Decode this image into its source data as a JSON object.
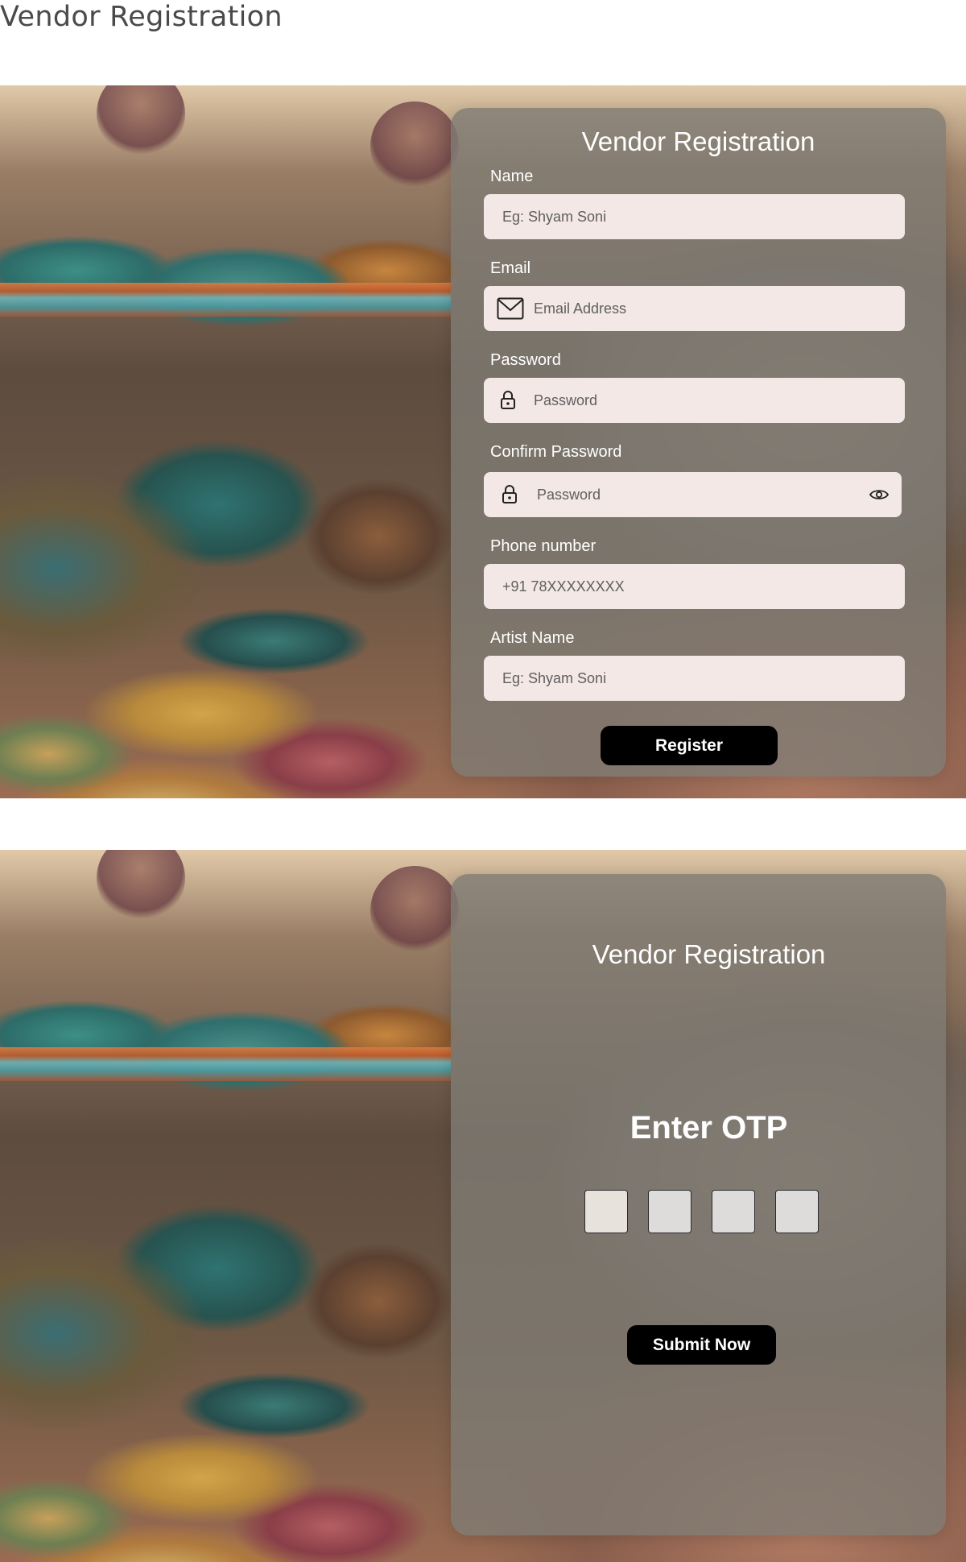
{
  "page_title": "Vendor Registration",
  "registration": {
    "title": "Vendor Registration",
    "fields": {
      "name": {
        "label": "Name",
        "placeholder": "Eg: Shyam Soni"
      },
      "email": {
        "label": "Email",
        "placeholder": "Email Address",
        "icon": "mail-icon"
      },
      "password": {
        "label": "Password",
        "placeholder": "Password",
        "icon": "lock-icon"
      },
      "confirm_password": {
        "label": "Confirm Password",
        "placeholder": "Password",
        "icon": "lock-icon",
        "toggle_icon": "eye-icon"
      },
      "phone": {
        "label": "Phone number",
        "placeholder": "+91 78XXXXXXXX"
      },
      "artist_name": {
        "label": "Artist Name",
        "placeholder": "Eg: Shyam Soni"
      }
    },
    "register_label": "Register"
  },
  "otp": {
    "title": "Vendor Registration",
    "heading": "Enter OTP",
    "digits": [
      "",
      "",
      "",
      ""
    ],
    "submit_label": "Submit Now"
  },
  "colors": {
    "card": "#807c74",
    "field_bg": "#f3e8e6",
    "button": "#000000",
    "text_light": "#ffffff"
  }
}
